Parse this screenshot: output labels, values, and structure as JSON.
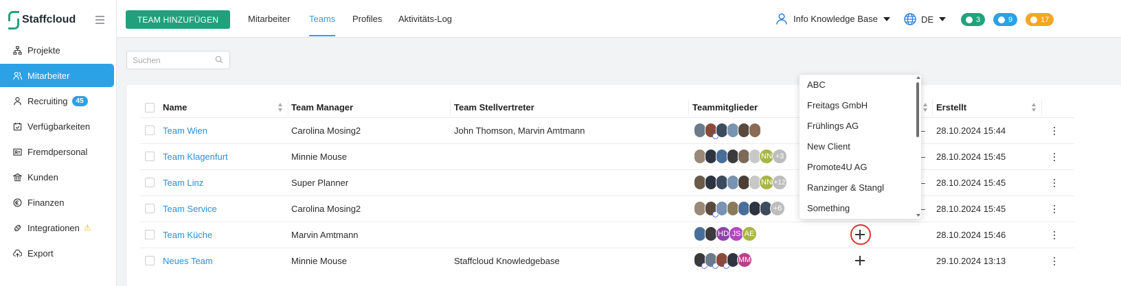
{
  "app": {
    "name": "Staffcloud"
  },
  "sidebar": {
    "items": [
      {
        "label": "Projekte",
        "icon": "sitemap-icon"
      },
      {
        "label": "Mitarbeiter",
        "icon": "users-icon",
        "active": true
      },
      {
        "label": "Recruiting",
        "icon": "user-icon",
        "badge": "45"
      },
      {
        "label": "Verfügbarkeiten",
        "icon": "calendar-check-icon"
      },
      {
        "label": "Fremdpersonal",
        "icon": "id-card-icon"
      },
      {
        "label": "Kunden",
        "icon": "bank-icon"
      },
      {
        "label": "Finanzen",
        "icon": "euro-icon"
      },
      {
        "label": "Integrationen",
        "icon": "plug-icon",
        "warning": "⚠"
      },
      {
        "label": "Export",
        "icon": "cloud-upload-icon"
      }
    ]
  },
  "topbar": {
    "add_button": "TEAM HINZUFÜGEN",
    "tabs": [
      {
        "label": "Mitarbeiter"
      },
      {
        "label": "Teams",
        "active": true
      },
      {
        "label": "Profiles"
      },
      {
        "label": "Aktivitäts-Log"
      }
    ],
    "user_label": "Info Knowledge Base",
    "language": "DE",
    "pills": [
      {
        "icon": "chat-icon",
        "count": "3",
        "color": "#1fa37d"
      },
      {
        "icon": "bell-icon",
        "count": "9",
        "color": "#2ba1e6"
      },
      {
        "icon": "clock-icon",
        "count": "17",
        "color": "#f5a623"
      }
    ]
  },
  "search": {
    "placeholder": "Suchen",
    "value": ""
  },
  "table": {
    "headers": {
      "name": "Name",
      "manager": "Team Manager",
      "deputy": "Team Stellvertreter",
      "members": "Teammitglieder",
      "created": "Erstellt"
    },
    "rows": [
      {
        "name": "Team Wien",
        "manager": "Carolina Mosing2",
        "deputy": "John Thomson, Marvin Amtmann",
        "created": "28.10.2024 15:44",
        "extra": []
      },
      {
        "name": "Team Klagenfurt",
        "manager": "Minnie Mouse",
        "deputy": "",
        "created": "28.10.2024 15:45",
        "extra": [
          "NN",
          "+3"
        ]
      },
      {
        "name": "Team Linz",
        "manager": "Super Planner",
        "deputy": "",
        "created": "28.10.2024 15:45",
        "extra": [
          "NN",
          "+12"
        ]
      },
      {
        "name": "Team Service",
        "manager": "Carolina Mosing2",
        "deputy": "",
        "created": "28.10.2024 15:45",
        "extra": [
          "+6"
        ]
      },
      {
        "name": "Team Küche",
        "manager": "Marvin Amtmann",
        "deputy": "",
        "created": "28.10.2024 15:46",
        "extra": [
          "HD",
          "JS",
          "AE"
        ]
      },
      {
        "name": "Neues Team",
        "manager": "Minnie Mouse",
        "deputy": "Staffcloud Knowledgebase",
        "created": "29.10.2024 13:13",
        "extra": [
          "MM"
        ]
      }
    ]
  },
  "dropdown": {
    "options": [
      "ABC",
      "Freitags GmbH",
      "Frühlings AG",
      "New Client",
      "Promote4U AG",
      "Ranzinger & Stangl",
      "Something"
    ]
  },
  "colors": {
    "accent": "#2ba1e6",
    "brand": "#21a07c",
    "highlight": "#e0332d"
  }
}
